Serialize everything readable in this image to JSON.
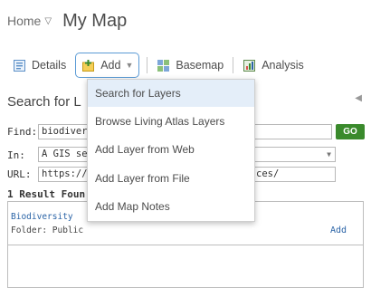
{
  "header": {
    "home": "Home",
    "title": "My Map"
  },
  "toolbar": {
    "details": "Details",
    "add": "Add",
    "basemap": "Basemap",
    "analysis": "Analysis"
  },
  "panel": {
    "title_visible": "Search for L",
    "find_label": "Find:",
    "find_value": "biodivers",
    "go": "GO",
    "in_label": "In:",
    "in_value": "A GIS ser",
    "url_label": "URL:",
    "url_value": "https://g",
    "url_suffix": "ces/",
    "results_count": "1 Result Foun"
  },
  "results": [
    {
      "name": "Biodiversity",
      "folder": "Folder: Public",
      "add": "Add"
    }
  ],
  "add_menu": {
    "items": [
      "Search for Layers",
      "Browse Living Atlas Layers",
      "Add Layer from Web",
      "Add Layer from File",
      "Add Map Notes"
    ],
    "selected_index": 0
  },
  "colors": {
    "go_button": "#3a8a2c",
    "link": "#2a63a6",
    "menu_selected": "#e4eef9",
    "active_border": "#5b9bd5"
  }
}
